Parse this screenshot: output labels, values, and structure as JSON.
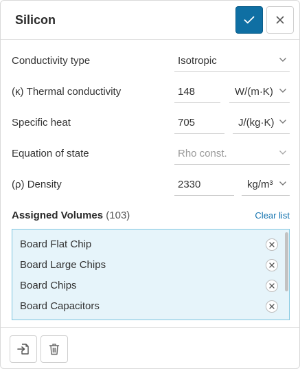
{
  "header": {
    "title": "Silicon",
    "confirm_icon": "check-icon",
    "close_icon": "close-icon"
  },
  "form": {
    "conductivity_type": {
      "label": "Conductivity type",
      "value": "Isotropic"
    },
    "thermal_conductivity": {
      "label": "(κ) Thermal conductivity",
      "value": "148",
      "unit": "W/(m·K)"
    },
    "specific_heat": {
      "label": "Specific heat",
      "value": "705",
      "unit": "J/(kg·K)"
    },
    "equation_of_state": {
      "label": "Equation of state",
      "value": "Rho const."
    },
    "density": {
      "label": "(ρ) Density",
      "value": "2330",
      "unit": "kg/m³"
    }
  },
  "assigned": {
    "title": "Assigned Volumes",
    "count": "(103)",
    "clear_label": "Clear list",
    "items": [
      {
        "name": "Board Flat Chip"
      },
      {
        "name": "Board Large Chips"
      },
      {
        "name": "Board Chips"
      },
      {
        "name": "Board Capacitors"
      }
    ]
  },
  "footer": {
    "import_icon": "import-icon",
    "delete_icon": "trash-icon"
  },
  "colors": {
    "accent": "#0f6fa3",
    "list_bg": "#e6f4fa",
    "list_border": "#7cc5e0",
    "link": "#1574b0"
  }
}
